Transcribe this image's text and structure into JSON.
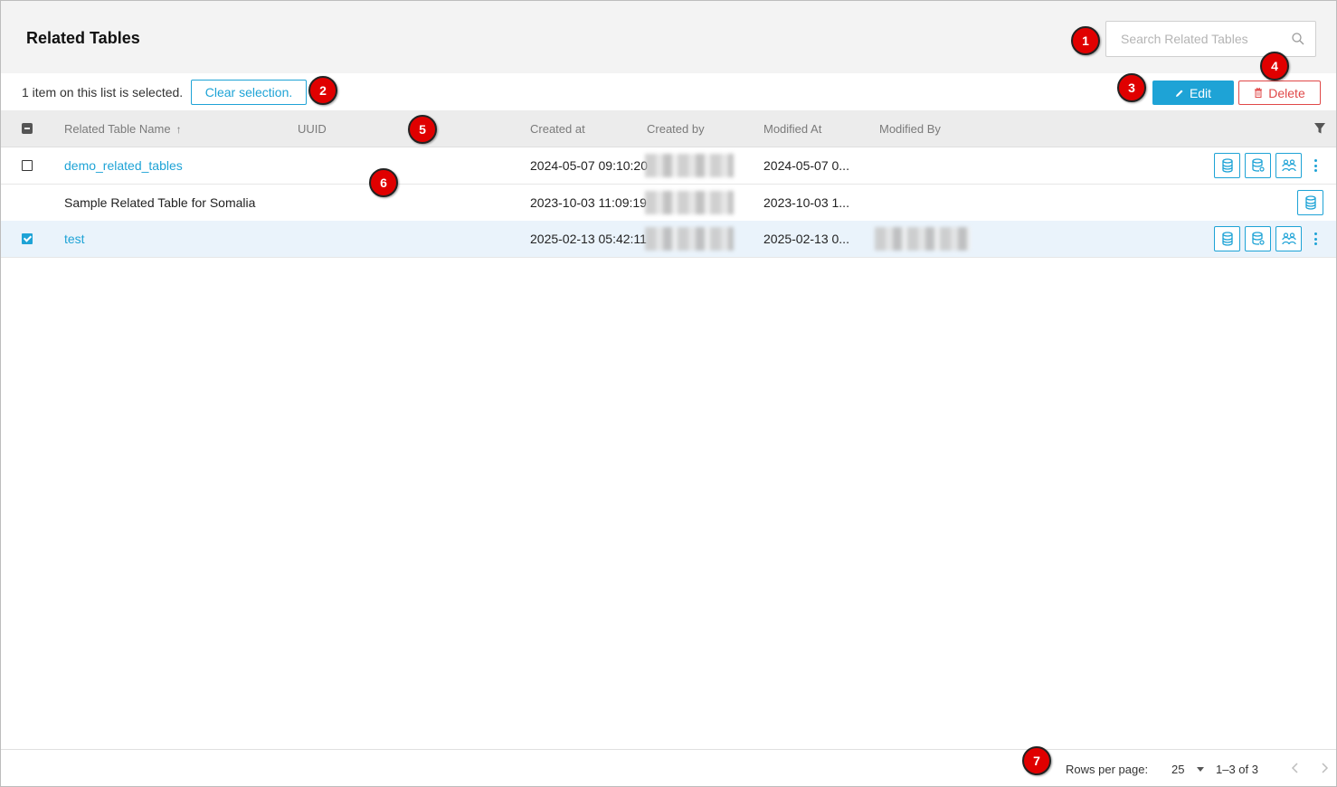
{
  "header": {
    "title": "Related Tables",
    "search_placeholder": "Search Related Tables"
  },
  "toolbar": {
    "selection_text": "1 item on this list is selected.",
    "clear_label": "Clear selection.",
    "edit_label": "Edit",
    "delete_label": "Delete"
  },
  "table": {
    "columns": [
      "Related Table Name",
      "UUID",
      "Created at",
      "Created by",
      "Modified At",
      "Modified By"
    ],
    "rows": [
      {
        "name": "demo_related_tables",
        "uuid": "",
        "created_at": "2024-05-07 09:10:20",
        "modified_at": "2024-05-07 0...",
        "selected": false
      },
      {
        "name": "Sample Related Table for Somalia",
        "uuid": "",
        "created_at": "2023-10-03 11:09:19",
        "modified_at": "2023-10-03 1...",
        "selected": false
      },
      {
        "name": "test",
        "uuid": "",
        "created_at": "2025-02-13 05:42:11",
        "modified_at": "2025-02-13 0...",
        "selected": true
      }
    ]
  },
  "footer": {
    "rows_per_page_label": "Rows per page:",
    "rows_per_page_value": "25",
    "range": "1–3 of 3"
  },
  "markers": [
    "1",
    "2",
    "3",
    "4",
    "5",
    "6",
    "7"
  ],
  "colors": {
    "accent": "#1ea3d6",
    "danger": "#e04848",
    "marker": "#e00000"
  }
}
